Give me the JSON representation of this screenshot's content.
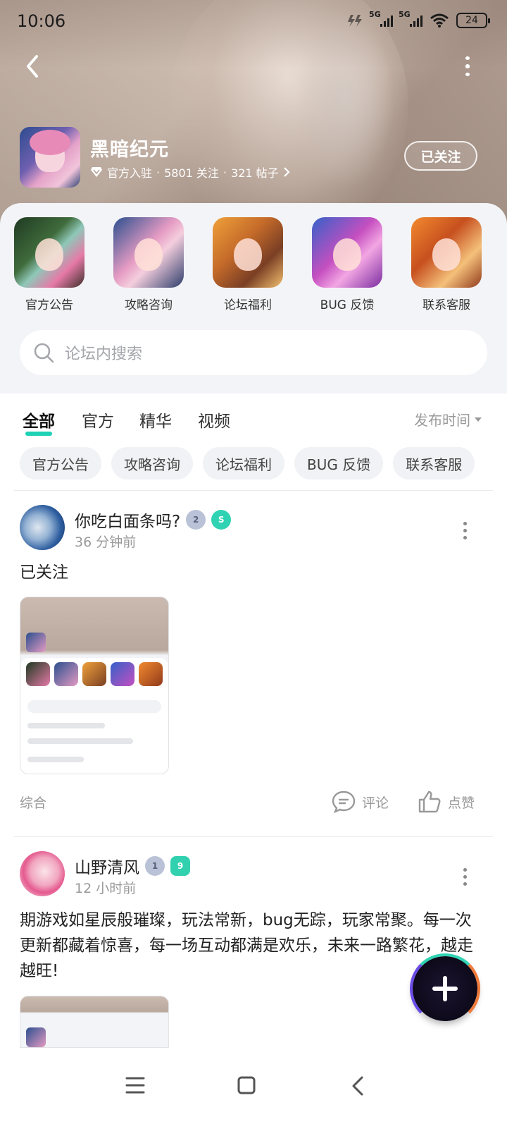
{
  "status_bar": {
    "time": "10:06",
    "signal1": "5G",
    "signal2": "5G",
    "battery": "24"
  },
  "header": {
    "forum_name": "黑暗纪元",
    "verified": "官方入驻",
    "followers": "5801 关注",
    "posts": "321 帖子",
    "follow_label": "已关注"
  },
  "categories": [
    {
      "label": "官方公告"
    },
    {
      "label": "攻略咨询"
    },
    {
      "label": "论坛福利"
    },
    {
      "label": "BUG 反馈"
    },
    {
      "label": "联系客服"
    }
  ],
  "search": {
    "placeholder": "论坛内搜索"
  },
  "tabs": [
    "全部",
    "官方",
    "精华",
    "视频"
  ],
  "sort_label": "发布时间",
  "chips": [
    "官方公告",
    "攻略咨询",
    "论坛福利",
    "BUG 反馈",
    "联系客服"
  ],
  "posts": [
    {
      "username": "你吃白面条吗?",
      "badge_t": "2",
      "time": "36 分钟前",
      "text": "已关注",
      "category": "综合",
      "comment_label": "评论",
      "like_label": "点赞"
    },
    {
      "username": "山野清风",
      "badge_t": "1",
      "level": "9",
      "time": "12 小时前",
      "text": "期游戏如星辰般璀璨，玩法常新，bug无踪，玩家常聚。每一次更新都藏着惊喜，每一场互动都满是欢乐，未来一路繁花，越走越旺!"
    }
  ],
  "colors": {
    "accent": "#1fd1b5",
    "chip_bg": "#f1f2f5",
    "muted_text": "#999999"
  },
  "icons": [
    "back-icon",
    "more-icon",
    "search-icon",
    "comment-icon",
    "like-icon",
    "plus-icon",
    "menu-icon",
    "home-icon",
    "nav-back-icon"
  ]
}
